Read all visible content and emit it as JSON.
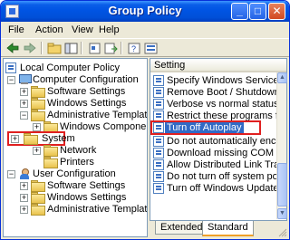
{
  "window": {
    "title": "Group Policy"
  },
  "menu": [
    "File",
    "Action",
    "View",
    "Help"
  ],
  "toolbar": [
    "back-icon",
    "forward-icon",
    "up-folder-icon",
    "show-hide-tree-icon",
    "properties-icon",
    "export-list-icon",
    "help-icon",
    "view-icon"
  ],
  "tree": {
    "root": "Local Computer Policy",
    "computer_config": "Computer Configuration",
    "cc_software": "Software Settings",
    "cc_windows": "Windows Settings",
    "cc_admin": "Administrative Templates",
    "cc_components": "Windows Components",
    "cc_system": "System",
    "cc_network": "Network",
    "cc_printers": "Printers",
    "user_config": "User Configuration",
    "uc_software": "Software Settings",
    "uc_windows": "Windows Settings",
    "uc_admin": "Administrative Templates"
  },
  "settings": {
    "header": "Setting",
    "rows": [
      "Specify Windows Service Pa...",
      "Remove Boot / Shutdown / L...",
      "Verbose vs normal status me...",
      "Restrict these programs fro...",
      "Turn off Autoplay",
      "Do not automatically encrypt...",
      "Download missing COM comp...",
      "Allow Distributed Link Tracking...",
      "Do not turn off system powe...",
      "Turn off Windows Update de..."
    ],
    "selected_index": 4
  },
  "tabs": [
    "Extended",
    "Standard"
  ],
  "active_tab": "Standard",
  "colors": {
    "highlight_box": "#e02020",
    "selection": "#316ac5",
    "titlebar": "#0054e3"
  }
}
